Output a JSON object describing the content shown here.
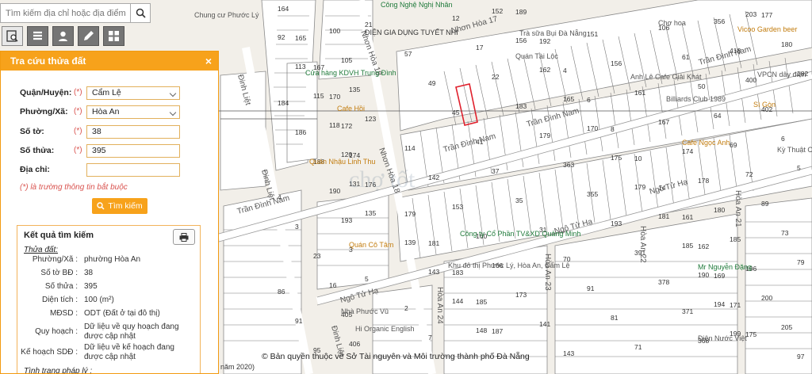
{
  "search": {
    "placeholder": "Tìm kiếm địa chỉ hoặc địa điểm"
  },
  "toolbar": {
    "items": [
      "parcel-lookup",
      "layers",
      "user",
      "edit",
      "grid"
    ]
  },
  "panel": {
    "title": "Tra cứu thửa đất",
    "close": "×",
    "fields": {
      "district_label": "Quận/Huyện:",
      "district_value": "Cẩm Lệ",
      "ward_label": "Phường/Xã:",
      "ward_value": "Hòa An",
      "sheet_label": "Số tờ:",
      "sheet_value": "38",
      "parcel_label": "Số thửa:",
      "parcel_value": "395",
      "address_label": "Địa chỉ:",
      "address_value": "",
      "required_mark": "(*)"
    },
    "note": "(*) là trường thông tin bắt buộc",
    "search_button": "Tìm kiếm",
    "result": {
      "title": "Kết quả tìm kiếm",
      "subtitle": "Thửa đất:",
      "rows": [
        {
          "k": "Phường/Xã :",
          "v": "phường Hòa An"
        },
        {
          "k": "Số tờ BĐ :",
          "v": "38"
        },
        {
          "k": "Số thửa :",
          "v": "395"
        },
        {
          "k": "Diện tích :",
          "v": "100 (m²)"
        },
        {
          "k": "MĐSD :",
          "v": "ODT (Đất ở tại đô thị)"
        },
        {
          "k": "Quy hoạch :",
          "v": "Dữ liệu về quy hoạch đang được cập nhật"
        },
        {
          "k": "Kế hoạch SDĐ :",
          "v": "Dữ liệu về kế hoạch đang được cập nhật"
        }
      ],
      "trailing": "Tình trạng pháp lý :"
    }
  },
  "map": {
    "streets": [
      "Trần Đình Nam",
      "Trần Đình Nam",
      "Trần Đình Nam",
      "Trần Đình Nam",
      "Ngô Tử Hạ",
      "Ngô Tử Hạ",
      "Ngô Tử Hạ",
      "Nhơn Hòa 17",
      "Nhơn Hòa 18",
      "Nhơn Hòa 18",
      "Đinh Liệt",
      "Đinh Liệt",
      "Đinh Liệt",
      "Hòa An 21",
      "Hòa An 22",
      "Hòa An 23",
      "Hòa An 24"
    ],
    "pois": [
      "Chung cư Phước Lý",
      "Công Nghệ Nghị Nhân",
      "ĐIỆN GIA DỤNG TUYẾT NHI",
      "Trà sữa Bụi Đà Nẵng",
      "Quán Tài Lộc",
      "Vicoo Garden beer",
      "Chợ hoa",
      "Anh Lê Cafe Giải Khát",
      "VPCN dây điện",
      "Billiards Club 1989",
      "Sì Gòn",
      "Cafe Ngọc Anh",
      "Kỳ Thuật Cơ",
      "Quán Nhậu Linh Thu",
      "Quán Cô Tâm",
      "Công ty Cổ Phần TV&XD Quảng Minh",
      "Khu đô thị Phước Lý, Hòa An, Cẩm Lệ",
      "Cửa hàng KDVH Trung Đình",
      "Cafe Hồi",
      "Hi Organic English",
      "Mr Nguyễn Đặng",
      "Điện Nước Việt",
      "Nhà Phước Vũ"
    ],
    "parcels": [
      "164",
      "165",
      "167",
      "170",
      "172",
      "174",
      "176",
      "179",
      "181",
      "183",
      "185",
      "187",
      "189",
      "192",
      "4",
      "6",
      "8",
      "10",
      "14",
      "161",
      "162",
      "169",
      "171",
      "175",
      "177",
      "180",
      "182",
      "184",
      "186",
      "188",
      "190",
      "193",
      "3",
      "5",
      "2",
      "7",
      "12",
      "17",
      "22",
      "183",
      "179",
      "363",
      "355",
      "193",
      "391",
      "378",
      "371",
      "368",
      "356",
      "418",
      "400",
      "402",
      "6",
      "5",
      "4",
      "3",
      "23",
      "16",
      "405",
      "406",
      "21",
      "57",
      "49",
      "45",
      "41",
      "37",
      "35",
      "31",
      "70",
      "91",
      "81",
      "71",
      "106",
      "61",
      "50",
      "64",
      "69",
      "72",
      "89",
      "73",
      "79",
      "86",
      "91",
      "95",
      "100",
      "105",
      "135",
      "123",
      "114",
      "142",
      "153",
      "160",
      "166",
      "173",
      "141",
      "143",
      "151",
      "156",
      "161",
      "167",
      "174",
      "178",
      "180",
      "185",
      "196",
      "200",
      "205",
      "97",
      "92",
      "113",
      "115",
      "118",
      "120",
      "131",
      "135",
      "139",
      "143",
      "144",
      "148",
      "152",
      "156",
      "162",
      "165",
      "170",
      "175",
      "179",
      "181",
      "185",
      "190",
      "194",
      "199",
      "203"
    ],
    "watermark": "chợ tốt"
  },
  "copyright": "© Bản quyền thuộc về Sở Tài nguyên và Môi trường thành phố Đà Nẵng",
  "footer_fragment": "năm 2020)",
  "colors": {
    "accent": "#f7a21b",
    "selected_parcel": "#e0202c",
    "road": "#ffffff",
    "lot_line": "#6f6f6f"
  }
}
